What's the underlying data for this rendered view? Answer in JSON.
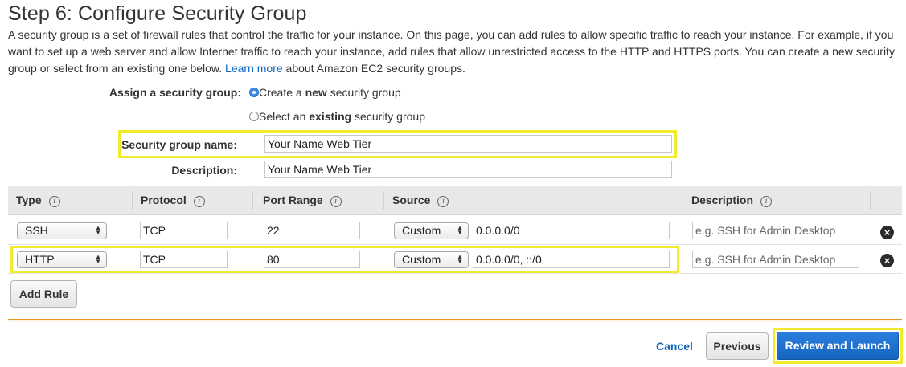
{
  "page": {
    "title": "Step 6: Configure Security Group",
    "intro": "A security group is a set of firewall rules that control the traffic for your instance. On this page, you can add rules to allow specific traffic to reach your instance. For example, if you want to set up a web server and allow Internet traffic to reach your instance, add rules that allow unrestricted access to the HTTP and HTTPS ports. You can create a new security group or select from an existing one below.",
    "learn_more": "Learn more",
    "intro_after": "about Amazon EC2 security groups."
  },
  "assign": {
    "label": "Assign a security group:",
    "option_create_pre": "Create a ",
    "option_create_bold": "new",
    "option_create_post": " security group",
    "option_existing_pre": "Select an ",
    "option_existing_bold": "existing",
    "option_existing_post": " security group",
    "selected": "create"
  },
  "form": {
    "name_label": "Security group name:",
    "name_value": "Your Name Web Tier",
    "desc_label": "Description:",
    "desc_value": "Your Name Web Tier"
  },
  "table": {
    "headers": [
      "Type",
      "Protocol",
      "Port Range",
      "Source",
      "Description"
    ],
    "rows": [
      {
        "type": "SSH",
        "protocol": "TCP",
        "port": "22",
        "source_type": "Custom",
        "source": "0.0.0.0/0",
        "desc_placeholder": "e.g. SSH for Admin Desktop"
      },
      {
        "type": "HTTP",
        "protocol": "TCP",
        "port": "80",
        "source_type": "Custom",
        "source": "0.0.0.0/0, ::/0",
        "desc_placeholder": "e.g. SSH for Admin Desktop"
      }
    ],
    "remove_icon": "×"
  },
  "buttons": {
    "add_rule": "Add Rule",
    "cancel": "Cancel",
    "previous": "Previous",
    "review_launch": "Review and Launch"
  },
  "colors": {
    "accent_blue": "#1665c1",
    "link_blue": "#1166bb",
    "highlight_yellow": "#f2ea2c",
    "warning_orange": "#e6922c"
  }
}
